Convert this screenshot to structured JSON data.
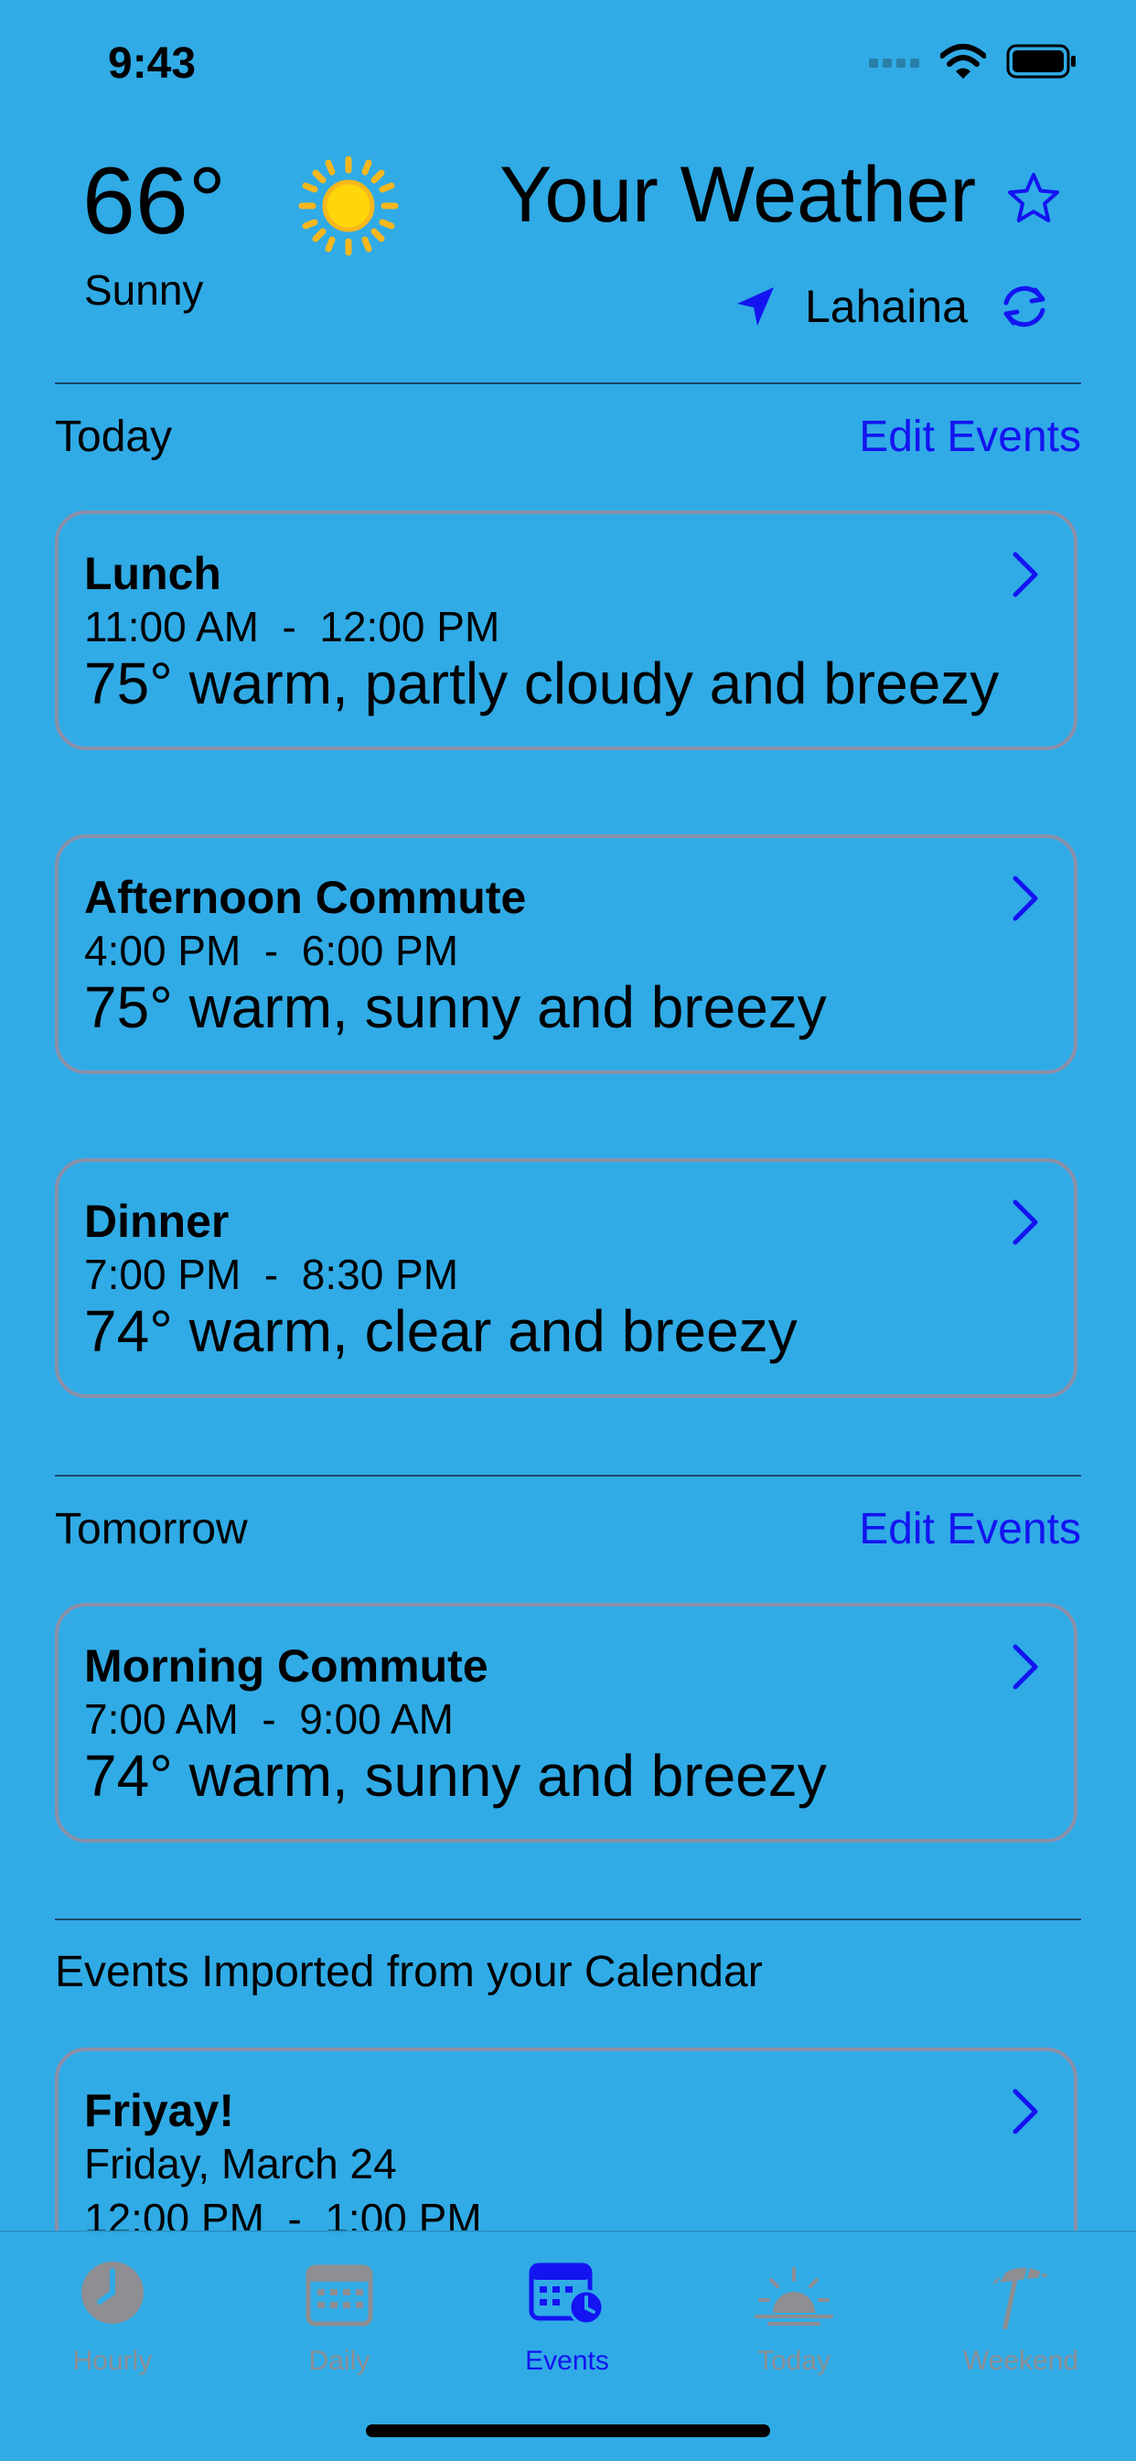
{
  "status_bar": {
    "time": "9:43"
  },
  "header": {
    "temperature": "66°",
    "condition": "Sunny",
    "title": "Your Weather",
    "location": "Lahaina",
    "accent_color": "#1414F0",
    "background_color": "#30ABE6"
  },
  "sections": {
    "today": {
      "title": "Today",
      "edit_label": "Edit Events"
    },
    "tomorrow": {
      "title": "Tomorrow",
      "edit_label": "Edit Events"
    },
    "imported": {
      "title": "Events Imported from your Calendar"
    }
  },
  "today_events": [
    {
      "title": "Lunch",
      "time": "11:00 AM  -  12:00 PM",
      "forecast": "75° warm, partly cloudy and breezy"
    },
    {
      "title": "Afternoon Commute",
      "time": "4:00 PM  -  6:00 PM",
      "forecast": "75° warm, sunny and breezy"
    },
    {
      "title": "Dinner",
      "time": "7:00 PM  -  8:30 PM",
      "forecast": "74° warm, clear and breezy"
    }
  ],
  "tomorrow_events": [
    {
      "title": "Morning Commute",
      "time": "7:00 AM  -  9:00 AM",
      "forecast": "74° warm, sunny and breezy"
    }
  ],
  "imported_events": [
    {
      "title": "Friyay!",
      "date": "Friday, March 24",
      "time": "12:00 PM  -  1:00 PM"
    }
  ],
  "tab_bar": {
    "tabs": [
      {
        "label": "Hourly",
        "icon": "clock-icon",
        "active": false
      },
      {
        "label": "Daily",
        "icon": "calendar-icon",
        "active": false
      },
      {
        "label": "Events",
        "icon": "calendar-clock-icon",
        "active": true
      },
      {
        "label": "Today",
        "icon": "sunrise-icon",
        "active": false
      },
      {
        "label": "Weekend",
        "icon": "beach-umbrella-icon",
        "active": false
      }
    ],
    "inactive_color": "#8E8E93",
    "active_color": "#1414F0"
  }
}
